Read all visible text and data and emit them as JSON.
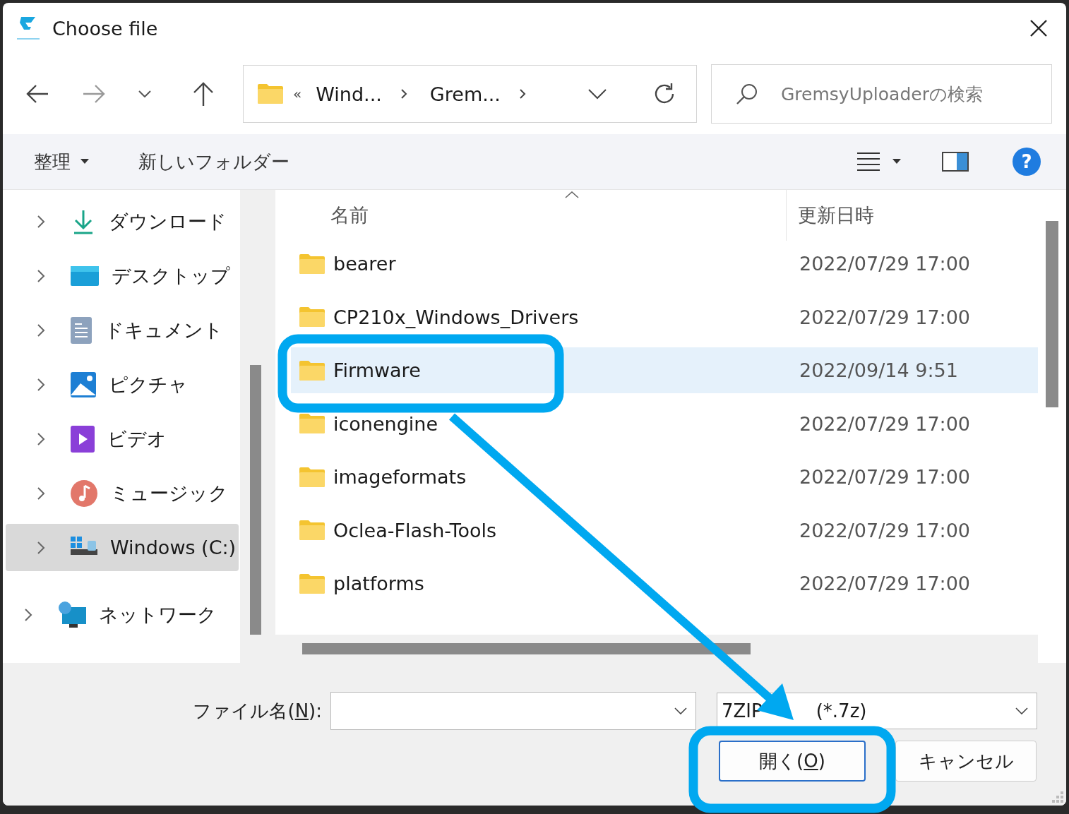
{
  "window": {
    "title": "Choose file"
  },
  "address": {
    "overflow": "«",
    "crumbs": [
      "Wind...",
      "Grem..."
    ]
  },
  "search": {
    "placeholder": "GremsyUploaderの検索"
  },
  "command_bar": {
    "organize": "整理",
    "new_folder": "新しいフォルダー",
    "help": "?"
  },
  "sidebar": {
    "items": [
      {
        "label": "ダウンロード",
        "kind": "download",
        "selected": false
      },
      {
        "label": "デスクトップ",
        "kind": "desktop",
        "selected": false
      },
      {
        "label": "ドキュメント",
        "kind": "documents",
        "selected": false
      },
      {
        "label": "ピクチャ",
        "kind": "pictures",
        "selected": false
      },
      {
        "label": "ビデオ",
        "kind": "videos",
        "selected": false
      },
      {
        "label": "ミュージック",
        "kind": "music",
        "selected": false
      },
      {
        "label": "Windows (C:)",
        "kind": "drive",
        "selected": true
      }
    ],
    "root_items": [
      {
        "label": "ネットワーク",
        "kind": "network",
        "selected": false
      }
    ]
  },
  "table": {
    "columns": [
      "名前",
      "更新日時"
    ],
    "rows": [
      {
        "name": "bearer",
        "modified": "2022/07/29 17:00",
        "selected": false
      },
      {
        "name": "CP210x_Windows_Drivers",
        "modified": "2022/07/29 17:00",
        "selected": false
      },
      {
        "name": "Firmware",
        "modified": "2022/09/14 9:51",
        "selected": true
      },
      {
        "name": "iconengine",
        "modified": "2022/07/29 17:00",
        "selected": false
      },
      {
        "name": "imageformats",
        "modified": "2022/07/29 17:00",
        "selected": false
      },
      {
        "name": "Oclea-Flash-Tools",
        "modified": "2022/07/29 17:00",
        "selected": false
      },
      {
        "name": "platforms",
        "modified": "2022/07/29 17:00",
        "selected": false
      }
    ]
  },
  "footer": {
    "file_name_label": {
      "before": "ファイル名(",
      "key": "N",
      "after": "):"
    },
    "file_type": [
      "7ZIP",
      "(*.7z)"
    ],
    "open_button": {
      "before": "開く(",
      "key": "O",
      "after": ")"
    },
    "cancel_button": "キャンセル"
  }
}
